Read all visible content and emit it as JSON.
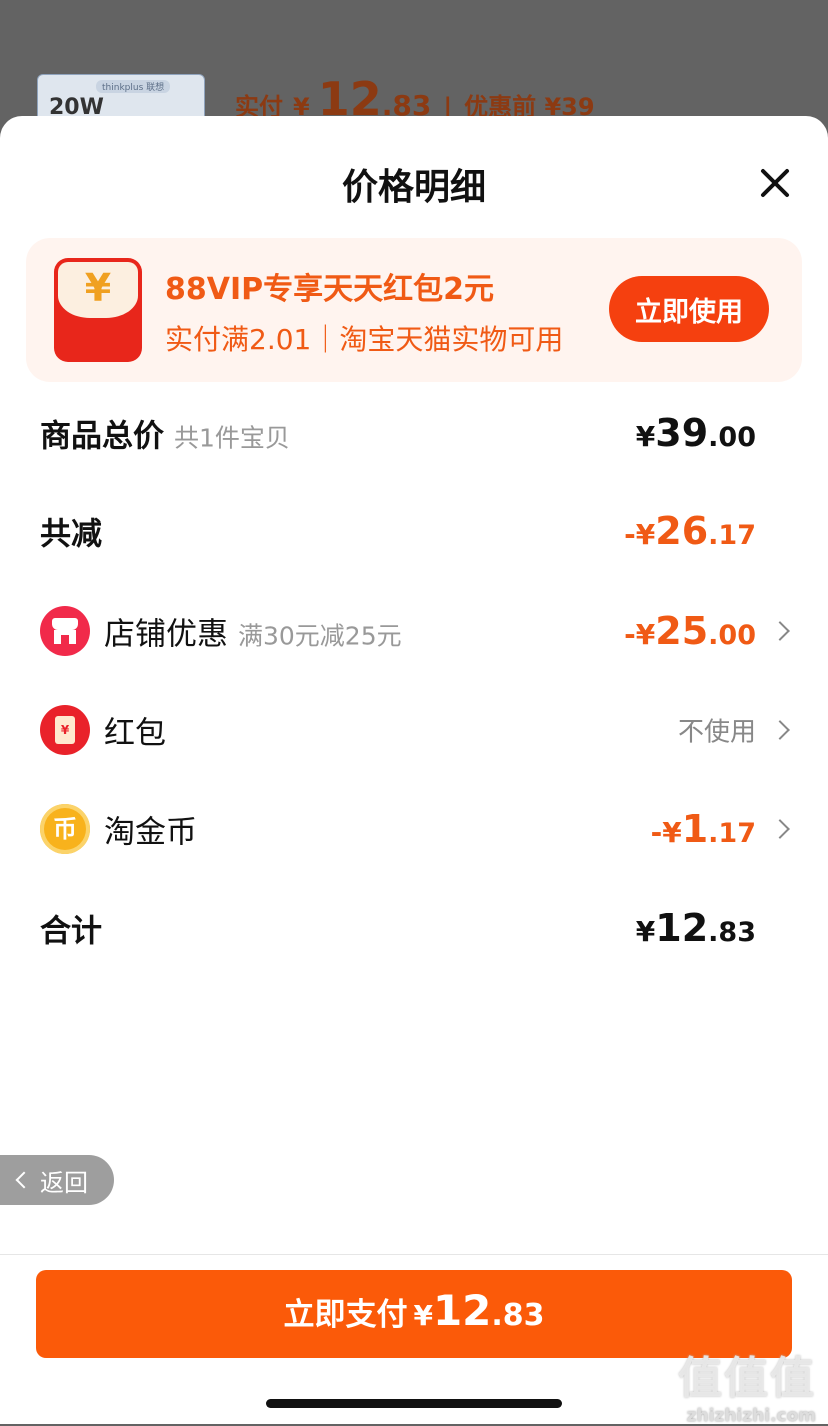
{
  "background": {
    "product_tag": "thinkplus 联想",
    "product_text": "20W",
    "paid_label": "实付",
    "paid_yen": "¥",
    "paid_int": "12",
    "paid_dec": ".83",
    "separator": "|",
    "original_label": "优惠前 ¥39"
  },
  "sheet": {
    "title": "价格明细"
  },
  "banner": {
    "yen_symbol": "¥",
    "title": "88VIP专享天天红包2元",
    "subtitle": "实付满2.01｜淘宝天猫实物可用",
    "button": "立即使用"
  },
  "rows": {
    "goods_total": {
      "label": "商品总价",
      "note": "共1件宝贝",
      "yen": "¥",
      "int": "39",
      "dec": ".00"
    },
    "total_reduce": {
      "label": "共减",
      "yen": "-¥",
      "int": "26",
      "dec": ".17"
    },
    "shop_discount": {
      "label": "店铺优惠",
      "note": "满30元减25元",
      "yen": "-¥",
      "int": "25",
      "dec": ".00"
    },
    "red_packet": {
      "label": "红包",
      "icon_text": "¥",
      "value": "不使用"
    },
    "tao_coin": {
      "label": "淘金币",
      "icon_text": "币",
      "yen": "-¥",
      "int": "1",
      "dec": ".17"
    },
    "total": {
      "label": "合计",
      "yen": "¥",
      "int": "12",
      "dec": ".83"
    }
  },
  "back": {
    "label": "返回"
  },
  "pay": {
    "label": "立即支付",
    "yen": "¥",
    "int": "12",
    "dec": ".83"
  },
  "watermark": {
    "zh": "值值值",
    "en": "zhizhizhi.com"
  },
  "icons": [
    "close-icon",
    "red-packet-icon",
    "shop-icon",
    "coin-icon",
    "chevron-right-icon",
    "chevron-left-icon"
  ],
  "colors": {
    "accent": "#f05a15",
    "button": "#fb5a09",
    "banner_bg": "#fff4ef"
  }
}
